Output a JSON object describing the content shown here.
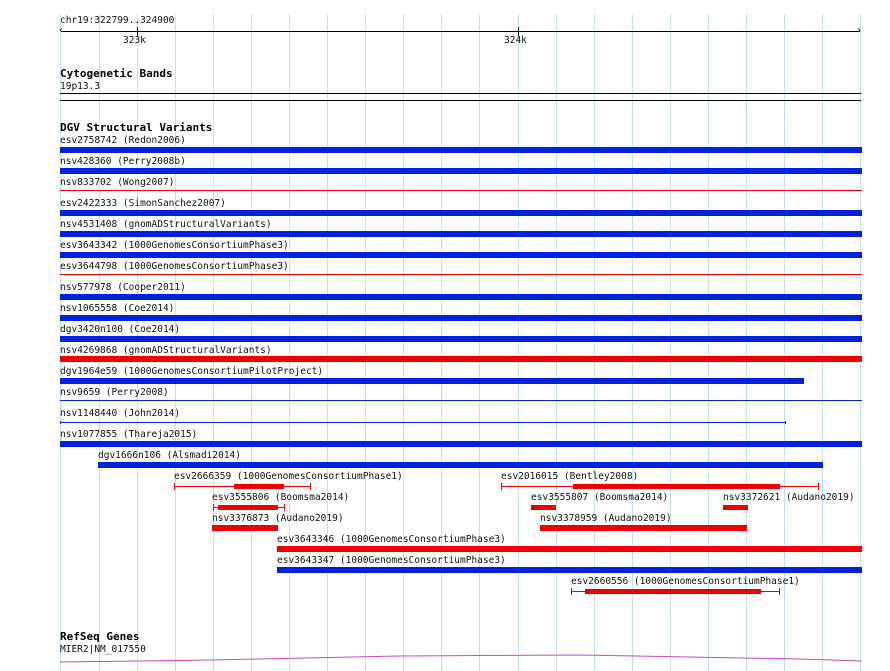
{
  "ruler": {
    "coords_label": "chr19:322799..324900",
    "tick_labels": [
      "323k",
      "324k"
    ]
  },
  "cytoband": {
    "title": "Cytogenetic Bands",
    "band_label": "19p13.3"
  },
  "dgv": {
    "title": "DGV Structural Variants",
    "colors": {
      "gain": "#0022dd",
      "loss": "#ee0000"
    },
    "features": [
      {
        "label": "esv2758742 (Redon2006)",
        "color": "gain"
      },
      {
        "label": "nsv428360 (Perry2008b)",
        "color": "gain"
      },
      {
        "label": "nsv833702 (Wong2007)",
        "color": "loss"
      },
      {
        "label": "esv2422333 (SimonSanchez2007)",
        "color": "gain"
      },
      {
        "label": "nsv4531408 (gnomADStructuralVariants)",
        "color": "gain"
      },
      {
        "label": "esv3643342 (1000GenomesConsortiumPhase3)",
        "color": "gain"
      },
      {
        "label": "esv3644798 (1000GenomesConsortiumPhase3)",
        "color": "loss"
      },
      {
        "label": "nsv577978 (Cooper2011)",
        "color": "gain"
      },
      {
        "label": "nsv1065558 (Coe2014)",
        "color": "gain"
      },
      {
        "label": "dgv3420n100 (Coe2014)",
        "color": "gain"
      },
      {
        "label": "nsv4269868 (gnomADStructuralVariants)",
        "color": "loss"
      },
      {
        "label": "dgv1964e59 (1000GenomesConsortiumPilotProject)",
        "color": "gain"
      },
      {
        "label": "nsv9659 (Perry2008)",
        "color": "gain"
      },
      {
        "label": "nsv1148440 (John2014)",
        "color": "gain"
      },
      {
        "label": "nsv1077855 (Thareja2015)",
        "color": "gain"
      },
      {
        "label": "dgv1666n106 (Alsmadi2014)",
        "color": "gain"
      },
      {
        "label": "esv2666359 (1000GenomesConsortiumPhase1)",
        "color": "loss"
      },
      {
        "label": "esv2016015 (Bentley2008)",
        "color": "loss"
      },
      {
        "label": "esv3555806 (Boomsma2014)",
        "color": "loss"
      },
      {
        "label": "esv3555807 (Boomsma2014)",
        "color": "loss"
      },
      {
        "label": "nsv3372621 (Audano2019)",
        "color": "loss"
      },
      {
        "label": "nsv3376873 (Audano2019)",
        "color": "loss"
      },
      {
        "label": "nsv3378959 (Audano2019)",
        "color": "loss"
      },
      {
        "label": "esv3643346 (1000GenomesConsortiumPhase3)",
        "color": "loss"
      },
      {
        "label": "esv3643347 (1000GenomesConsortiumPhase3)",
        "color": "gain"
      },
      {
        "label": "esv2660556 (1000GenomesConsortiumPhase1)",
        "color": "loss"
      }
    ]
  },
  "refseq": {
    "title": "RefSeq Genes",
    "gene_label": "MIER2|NM_017550",
    "color": "#cc44cc"
  }
}
